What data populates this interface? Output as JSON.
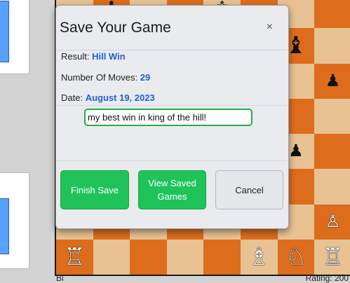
{
  "modal": {
    "title": "Save Your Game",
    "close_glyph": "×",
    "result_label": "Result:",
    "result_value": "Hill Win",
    "moves_label": "Number Of Moves:",
    "moves_value": "29",
    "date_label": "Date:",
    "date_value": "August 19, 2023",
    "note_value": "my best win in king of the hill!",
    "finish_save_label": "Finish Save",
    "view_saved_label": "View Saved Games",
    "cancel_label": "Cancel"
  },
  "board": {
    "pieces": {
      "b_top_1": "♝",
      "b_top_2": "♚",
      "b_bishop_r1": "♝",
      "b_pawn_r2": "♟",
      "b_pawn_r4": "♟",
      "w_pawn_r6": "♙",
      "w_rook_a": "♖",
      "w_bishop": "♗",
      "w_knight": "♘",
      "w_rook_h": "♖"
    },
    "light_color": "#e8c293",
    "dark_color": "#dd6d1d"
  },
  "footer": {
    "left_partial": "Bi",
    "right_partial": "Rating: 200"
  },
  "colors": {
    "accent_green": "#1fc35a",
    "value_blue": "#1f5fd6",
    "panel_blue": "#5aa0ff"
  }
}
